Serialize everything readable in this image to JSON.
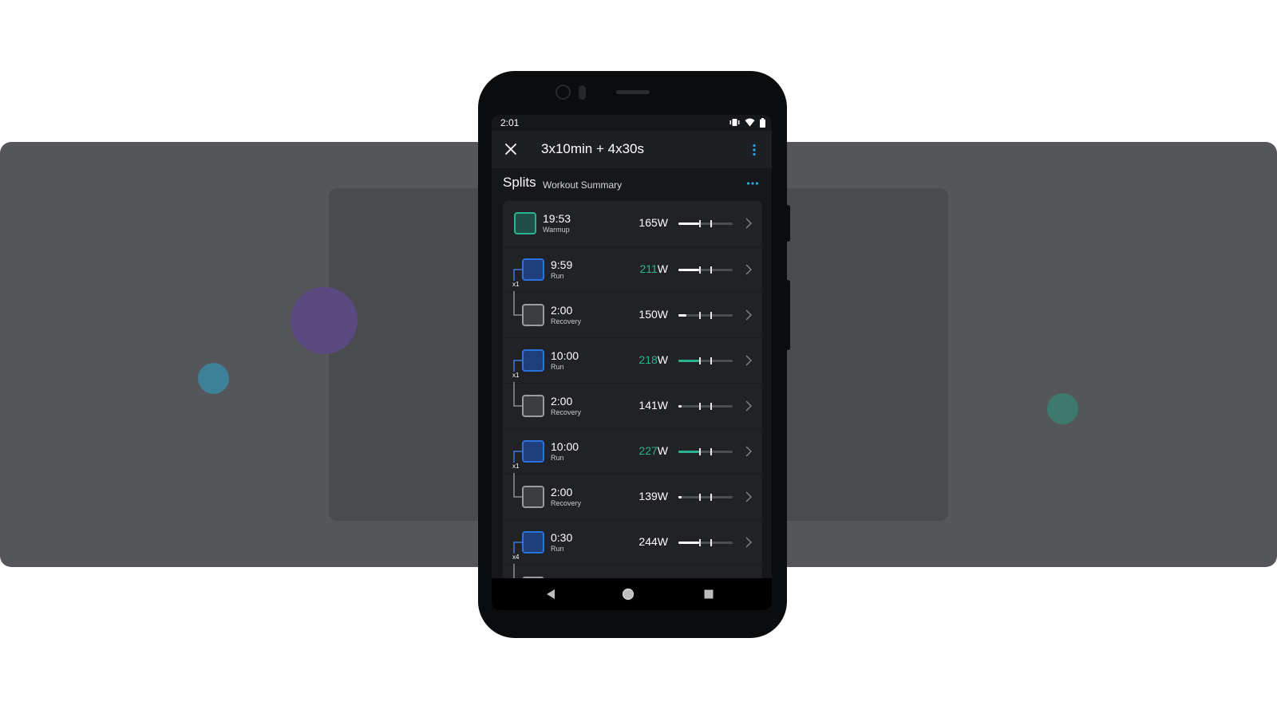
{
  "status": {
    "time": "2:01"
  },
  "appbar": {
    "title": "3x10min + 4x30s"
  },
  "section": {
    "title": "Splits",
    "subtitle": "Workout Summary"
  },
  "colors": {
    "accent_teal": "#2bb38f",
    "accent_blue": "#1e6fd9",
    "chip_blue_fill": "#1f3e7a",
    "chip_teal_fill": "#1f4f45",
    "chip_gray_fill": "#3a3c40"
  },
  "splits": [
    {
      "time": "19:53",
      "label": "Warmup",
      "watts": "165",
      "unit": "W",
      "highlight": false,
      "chip": "teal",
      "fill": 0.38,
      "fill_color": "white"
    },
    {
      "time": "9:59",
      "label": "Run",
      "watts": "211",
      "unit": "W",
      "highlight": true,
      "chip": "blue",
      "repeat": "x1",
      "fill": 0.38,
      "fill_color": "white"
    },
    {
      "time": "2:00",
      "label": "Recovery",
      "watts": "150",
      "unit": "W",
      "highlight": false,
      "chip": "gray",
      "fill": 0.14,
      "fill_color": "white"
    },
    {
      "time": "10:00",
      "label": "Run",
      "watts": "218",
      "unit": "W",
      "highlight": true,
      "chip": "blue",
      "repeat": "x1",
      "fill": 0.38,
      "fill_color": "teal"
    },
    {
      "time": "2:00",
      "label": "Recovery",
      "watts": "141",
      "unit": "W",
      "highlight": false,
      "chip": "gray",
      "fill": 0.06,
      "fill_color": "white"
    },
    {
      "time": "10:00",
      "label": "Run",
      "watts": "227",
      "unit": "W",
      "highlight": true,
      "chip": "blue",
      "repeat": "x1",
      "fill": 0.38,
      "fill_color": "teal"
    },
    {
      "time": "2:00",
      "label": "Recovery",
      "watts": "139",
      "unit": "W",
      "highlight": false,
      "chip": "gray",
      "fill": 0.06,
      "fill_color": "white"
    },
    {
      "time": "0:30",
      "label": "Run",
      "watts": "244",
      "unit": "W",
      "highlight": false,
      "chip": "blue",
      "repeat": "x4",
      "fill": 0.38,
      "fill_color": "white"
    },
    {
      "time": "",
      "label": "",
      "watts": "",
      "unit": "",
      "highlight": false,
      "chip": "gray",
      "fill": 0,
      "fill_color": "white"
    }
  ]
}
